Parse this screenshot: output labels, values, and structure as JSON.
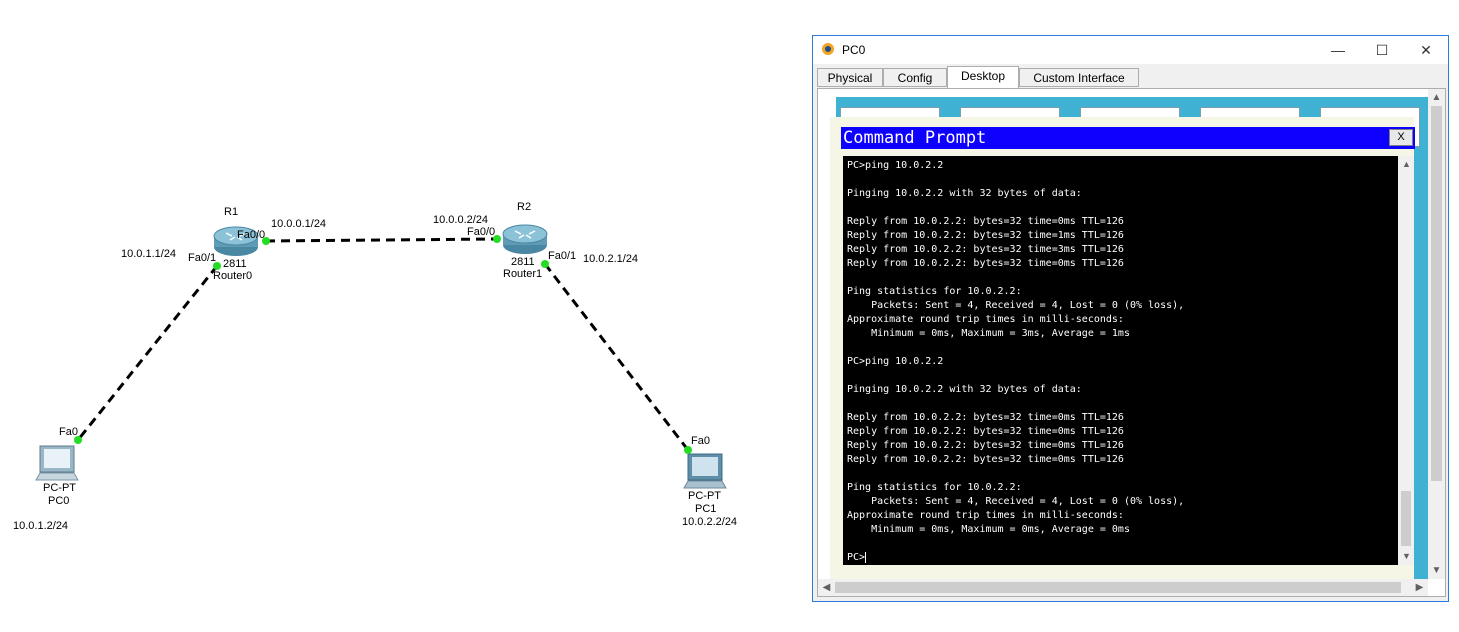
{
  "topology": {
    "routers": [
      {
        "name": "R1",
        "model": "2811",
        "label": "Router0"
      },
      {
        "name": "R2",
        "model": "2811",
        "label": "Router1"
      }
    ],
    "pcs": [
      {
        "model": "PC-PT",
        "label": "PC0",
        "ip": "10.0.1.2/24"
      },
      {
        "model": "PC-PT",
        "label": "PC1",
        "ip": "10.0.2.2/24"
      }
    ],
    "interfaces": {
      "r1_fa00": "Fa0/0",
      "r1_fa01": "Fa0/1",
      "r2_fa00": "Fa0/0",
      "r2_fa01": "Fa0/1",
      "pc0_fa0": "Fa0",
      "pc1_fa0": "Fa0"
    },
    "ips": {
      "r1_fa00": "10.0.0.1/24",
      "r1_fa01": "10.0.1.1/24",
      "r2_fa00": "10.0.0.2/24",
      "r2_fa01": "10.0.2.1/24"
    },
    "colors": {
      "link": "#000000",
      "port_up": "#22dd22",
      "router_body": "#5f9bb5"
    }
  },
  "window": {
    "title": "PC0",
    "controls": {
      "minimize": "—",
      "maximize": "☐",
      "close": "✕"
    },
    "tabs": [
      {
        "label": "Physical"
      },
      {
        "label": "Config"
      },
      {
        "label": "Desktop",
        "active": true
      },
      {
        "label": "Custom Interface"
      }
    ],
    "accent": "#2b79d9"
  },
  "command_prompt": {
    "title": "Command Prompt",
    "close_label": "X",
    "lines": [
      "PC>ping 10.0.2.2",
      "",
      "Pinging 10.0.2.2 with 32 bytes of data:",
      "",
      "Reply from 10.0.2.2: bytes=32 time=0ms TTL=126",
      "Reply from 10.0.2.2: bytes=32 time=1ms TTL=126",
      "Reply from 10.0.2.2: bytes=32 time=3ms TTL=126",
      "Reply from 10.0.2.2: bytes=32 time=0ms TTL=126",
      "",
      "Ping statistics for 10.0.2.2:",
      "    Packets: Sent = 4, Received = 4, Lost = 0 (0% loss),",
      "Approximate round trip times in milli-seconds:",
      "    Minimum = 0ms, Maximum = 3ms, Average = 1ms",
      "",
      "PC>ping 10.0.2.2",
      "",
      "Pinging 10.0.2.2 with 32 bytes of data:",
      "",
      "Reply from 10.0.2.2: bytes=32 time=0ms TTL=126",
      "Reply from 10.0.2.2: bytes=32 time=0ms TTL=126",
      "Reply from 10.0.2.2: bytes=32 time=0ms TTL=126",
      "Reply from 10.0.2.2: bytes=32 time=0ms TTL=126",
      "",
      "Ping statistics for 10.0.2.2:",
      "    Packets: Sent = 4, Received = 4, Lost = 0 (0% loss),",
      "Approximate round trip times in milli-seconds:",
      "    Minimum = 0ms, Maximum = 0ms, Average = 0ms",
      "",
      "PC>"
    ],
    "colors": {
      "title_bar": "#0d00ff",
      "background": "#000000",
      "text": "#ffffff"
    }
  }
}
